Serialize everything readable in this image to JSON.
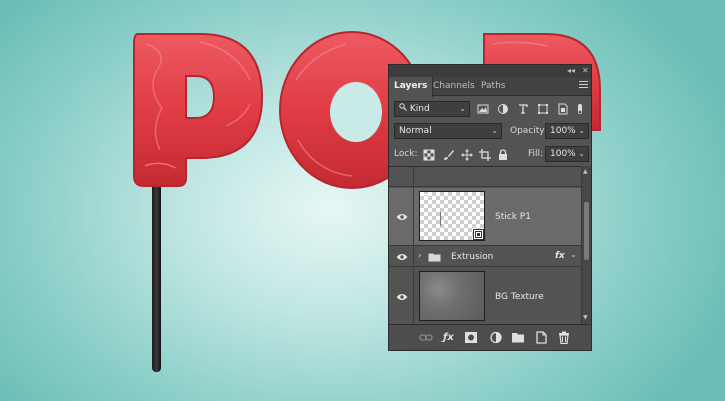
{
  "panel": {
    "tabs": [
      {
        "label": "Layers",
        "active": true
      },
      {
        "label": "Channels",
        "active": false
      },
      {
        "label": "Paths",
        "active": false
      }
    ],
    "filter": {
      "value": "Kind"
    },
    "blend": {
      "mode": "Normal",
      "opacity_label": "Opacity:",
      "opacity": "100%"
    },
    "lock": {
      "label": "Lock:",
      "fill_label": "Fill:",
      "fill": "100%"
    },
    "layers": [
      {
        "name": "Stick P1",
        "selected": true,
        "visible": true
      },
      {
        "name": "Extrusion",
        "type": "group",
        "fx": "fx",
        "visible": true
      },
      {
        "name": "BG Texture",
        "visible": true
      }
    ],
    "collapse_symbol": "◂◂",
    "close_symbol": "✕"
  },
  "colors": {
    "candy": "#e03c44",
    "panel_bg": "#535353",
    "selected_row": "#6a6a6a"
  }
}
